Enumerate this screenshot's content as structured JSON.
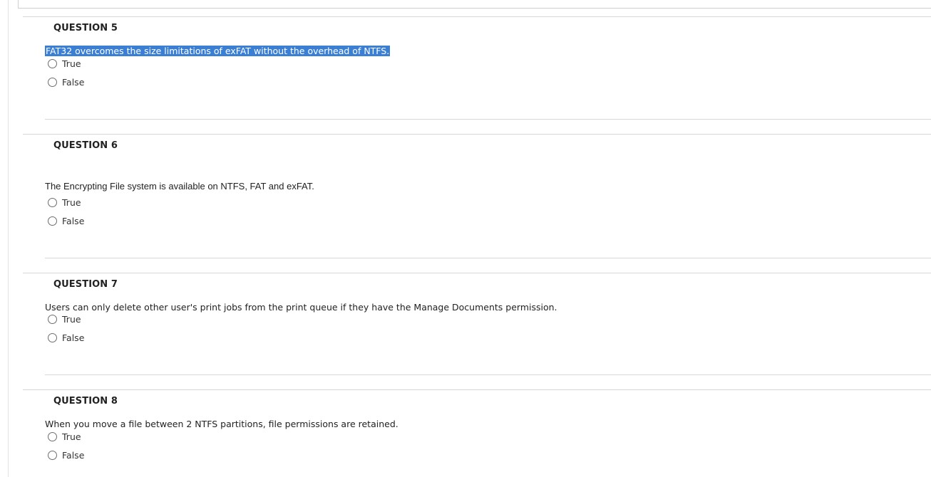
{
  "questions": [
    {
      "title": "QUESTION 5",
      "text": "FAT32 overcomes the size limitations of exFAT without the overhead of NTFS.",
      "options": [
        "True",
        "False"
      ]
    },
    {
      "title": "QUESTION 6",
      "text": "The Encrypting File system is available on NTFS, FAT and exFAT.",
      "options": [
        "True",
        "False"
      ]
    },
    {
      "title": "QUESTION 7",
      "text": "Users can only delete other user's print jobs from the print queue if they have the Manage Documents permission.",
      "options": [
        "True",
        "False"
      ]
    },
    {
      "title": "QUESTION 8",
      "text": "When you move a file between 2 NTFS partitions, file permissions are retained.",
      "options": [
        "True",
        "False"
      ]
    }
  ]
}
